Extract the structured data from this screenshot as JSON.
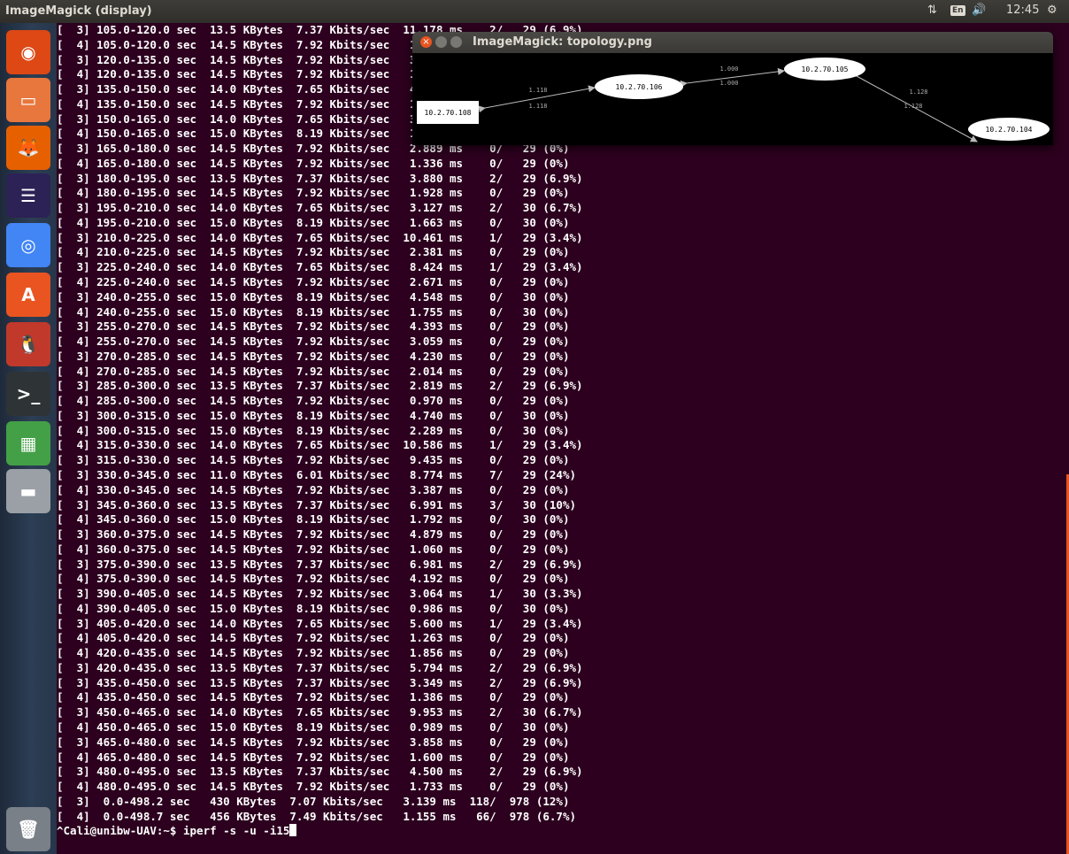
{
  "topbar": {
    "app_title": "ImageMagick (display)",
    "network_icon": "⇅",
    "keyboard_layout": "En",
    "volume_icon": "🔊",
    "clock": "12:45",
    "settings_icon": "⚙"
  },
  "launcher": {
    "items": [
      {
        "name": "dash-home-icon",
        "color": "#dd4814",
        "glyph": "◉",
        "top": 0
      },
      {
        "name": "files-icon",
        "color": "#e8773d",
        "glyph": "▭",
        "top": 0
      },
      {
        "name": "firefox-icon",
        "color": "#e66000",
        "glyph": "🦊",
        "top": 0
      },
      {
        "name": "eclipse-icon",
        "color": "#2c2255",
        "glyph": "☰",
        "top": 0
      },
      {
        "name": "chrome-icon",
        "color": "#4285f4",
        "glyph": "◎",
        "top": 0
      },
      {
        "name": "software-center-icon",
        "color": "#e95420",
        "glyph": "A",
        "top": 0
      },
      {
        "name": "app-penguin-icon",
        "color": "#c0392b",
        "glyph": "🐧",
        "top": 0
      },
      {
        "name": "terminal-icon",
        "color": "#2e3436",
        "glyph": ">_",
        "top": 0
      },
      {
        "name": "spreadsheet-icon",
        "color": "#43a047",
        "glyph": "▦",
        "top": 0
      },
      {
        "name": "disk-icon",
        "color": "#9aa0a6",
        "glyph": "▬",
        "top": 0
      },
      {
        "name": "trash-icon",
        "color": "#7a8088",
        "glyph": "🗑",
        "top": 0
      }
    ]
  },
  "image_window": {
    "title": "ImageMagick: topology.png",
    "close_glyph": "×",
    "nodes": [
      "10.2.70.108",
      "10.2.70.106",
      "10.2.70.105",
      "10.2.70.104"
    ],
    "edge_labels": [
      "1.118",
      "1.118",
      "1.000",
      "1.000",
      "1.128",
      "1.128"
    ]
  },
  "terminal": {
    "lines": [
      "[  3] 105.0-120.0 sec  13.5 KBytes  7.37 Kbits/sec  11.178 ms    2/   29 (6.9%)",
      "[  4] 105.0-120.0 sec  14.5 KBytes  7.92 Kbits/sec   1.571 ms    0/   29 (0%)",
      "[  3] 120.0-135.0 sec  14.5 KBytes  7.92 Kbits/sec   3.115 ms    0/   29 (0%)",
      "[  4] 120.0-135.0 sec  14.5 KBytes  7.92 Kbits/sec   1.486 ms    0/   29 (0%)",
      "[  3] 135.0-150.0 sec  14.0 KBytes  7.65 Kbits/sec   4.012 ms    1/   29 (3.4%)",
      "[  4] 135.0-150.0 sec  14.5 KBytes  7.92 Kbits/sec   1.218 ms    0/   29 (0%)",
      "[  3] 150.0-165.0 sec  14.0 KBytes  7.65 Kbits/sec   3.337 ms    1/   29 (3.4%)",
      "[  4] 150.0-165.0 sec  15.0 KBytes  8.19 Kbits/sec   1.905 ms    0/   30 (0%)",
      "[  3] 165.0-180.0 sec  14.5 KBytes  7.92 Kbits/sec   2.889 ms    0/   29 (0%)",
      "[  4] 165.0-180.0 sec  14.5 KBytes  7.92 Kbits/sec   1.336 ms    0/   29 (0%)",
      "[  3] 180.0-195.0 sec  13.5 KBytes  7.37 Kbits/sec   3.880 ms    2/   29 (6.9%)",
      "[  4] 180.0-195.0 sec  14.5 KBytes  7.92 Kbits/sec   1.928 ms    0/   29 (0%)",
      "[  3] 195.0-210.0 sec  14.0 KBytes  7.65 Kbits/sec   3.127 ms    2/   30 (6.7%)",
      "[  4] 195.0-210.0 sec  15.0 KBytes  8.19 Kbits/sec   1.663 ms    0/   30 (0%)",
      "[  3] 210.0-225.0 sec  14.0 KBytes  7.65 Kbits/sec  10.461 ms    1/   29 (3.4%)",
      "[  4] 210.0-225.0 sec  14.5 KBytes  7.92 Kbits/sec   2.381 ms    0/   29 (0%)",
      "[  3] 225.0-240.0 sec  14.0 KBytes  7.65 Kbits/sec   8.424 ms    1/   29 (3.4%)",
      "[  4] 225.0-240.0 sec  14.5 KBytes  7.92 Kbits/sec   2.671 ms    0/   29 (0%)",
      "[  3] 240.0-255.0 sec  15.0 KBytes  8.19 Kbits/sec   4.548 ms    0/   30 (0%)",
      "[  4] 240.0-255.0 sec  15.0 KBytes  8.19 Kbits/sec   1.755 ms    0/   30 (0%)",
      "[  3] 255.0-270.0 sec  14.5 KBytes  7.92 Kbits/sec   4.393 ms    0/   29 (0%)",
      "[  4] 255.0-270.0 sec  14.5 KBytes  7.92 Kbits/sec   3.059 ms    0/   29 (0%)",
      "[  3] 270.0-285.0 sec  14.5 KBytes  7.92 Kbits/sec   4.230 ms    0/   29 (0%)",
      "[  4] 270.0-285.0 sec  14.5 KBytes  7.92 Kbits/sec   2.014 ms    0/   29 (0%)",
      "[  3] 285.0-300.0 sec  13.5 KBytes  7.37 Kbits/sec   2.819 ms    2/   29 (6.9%)",
      "[  4] 285.0-300.0 sec  14.5 KBytes  7.92 Kbits/sec   0.970 ms    0/   29 (0%)",
      "[  3] 300.0-315.0 sec  15.0 KBytes  8.19 Kbits/sec   4.740 ms    0/   30 (0%)",
      "[  4] 300.0-315.0 sec  15.0 KBytes  8.19 Kbits/sec   2.289 ms    0/   30 (0%)",
      "[  4] 315.0-330.0 sec  14.0 KBytes  7.65 Kbits/sec  10.586 ms    1/   29 (3.4%)",
      "[  3] 315.0-330.0 sec  14.5 KBytes  7.92 Kbits/sec   9.435 ms    0/   29 (0%)",
      "[  3] 330.0-345.0 sec  11.0 KBytes  6.01 Kbits/sec   8.774 ms    7/   29 (24%)",
      "[  4] 330.0-345.0 sec  14.5 KBytes  7.92 Kbits/sec   3.387 ms    0/   29 (0%)",
      "[  3] 345.0-360.0 sec  13.5 KBytes  7.37 Kbits/sec   6.991 ms    3/   30 (10%)",
      "[  4] 345.0-360.0 sec  15.0 KBytes  8.19 Kbits/sec   1.792 ms    0/   30 (0%)",
      "[  3] 360.0-375.0 sec  14.5 KBytes  7.92 Kbits/sec   4.879 ms    0/   29 (0%)",
      "[  4] 360.0-375.0 sec  14.5 KBytes  7.92 Kbits/sec   1.060 ms    0/   29 (0%)",
      "[  3] 375.0-390.0 sec  13.5 KBytes  7.37 Kbits/sec   6.981 ms    2/   29 (6.9%)",
      "[  4] 375.0-390.0 sec  14.5 KBytes  7.92 Kbits/sec   4.192 ms    0/   29 (0%)",
      "[  3] 390.0-405.0 sec  14.5 KBytes  7.92 Kbits/sec   3.064 ms    1/   30 (3.3%)",
      "[  4] 390.0-405.0 sec  15.0 KBytes  8.19 Kbits/sec   0.986 ms    0/   30 (0%)",
      "[  3] 405.0-420.0 sec  14.0 KBytes  7.65 Kbits/sec   5.600 ms    1/   29 (3.4%)",
      "[  4] 405.0-420.0 sec  14.5 KBytes  7.92 Kbits/sec   1.263 ms    0/   29 (0%)",
      "[  4] 420.0-435.0 sec  14.5 KBytes  7.92 Kbits/sec   1.856 ms    0/   29 (0%)",
      "[  3] 420.0-435.0 sec  13.5 KBytes  7.37 Kbits/sec   5.794 ms    2/   29 (6.9%)",
      "[  3] 435.0-450.0 sec  13.5 KBytes  7.37 Kbits/sec   3.349 ms    2/   29 (6.9%)",
      "[  4] 435.0-450.0 sec  14.5 KBytes  7.92 Kbits/sec   1.386 ms    0/   29 (0%)",
      "[  3] 450.0-465.0 sec  14.0 KBytes  7.65 Kbits/sec   9.953 ms    2/   30 (6.7%)",
      "[  4] 450.0-465.0 sec  15.0 KBytes  8.19 Kbits/sec   0.989 ms    0/   30 (0%)",
      "[  3] 465.0-480.0 sec  14.5 KBytes  7.92 Kbits/sec   3.858 ms    0/   29 (0%)",
      "[  4] 465.0-480.0 sec  14.5 KBytes  7.92 Kbits/sec   1.600 ms    0/   29 (0%)",
      "[  3] 480.0-495.0 sec  13.5 KBytes  7.37 Kbits/sec   4.500 ms    2/   29 (6.9%)",
      "[  4] 480.0-495.0 sec  14.5 KBytes  7.92 Kbits/sec   1.733 ms    0/   29 (0%)",
      "[  3]  0.0-498.2 sec   430 KBytes  7.07 Kbits/sec   3.139 ms  118/  978 (12%)",
      "[  4]  0.0-498.7 sec   456 KBytes  7.49 Kbits/sec   1.155 ms   66/  978 (6.7%)"
    ],
    "prompt": "^Cali@unibw-UAV:~$ iperf -s -u -i15"
  }
}
